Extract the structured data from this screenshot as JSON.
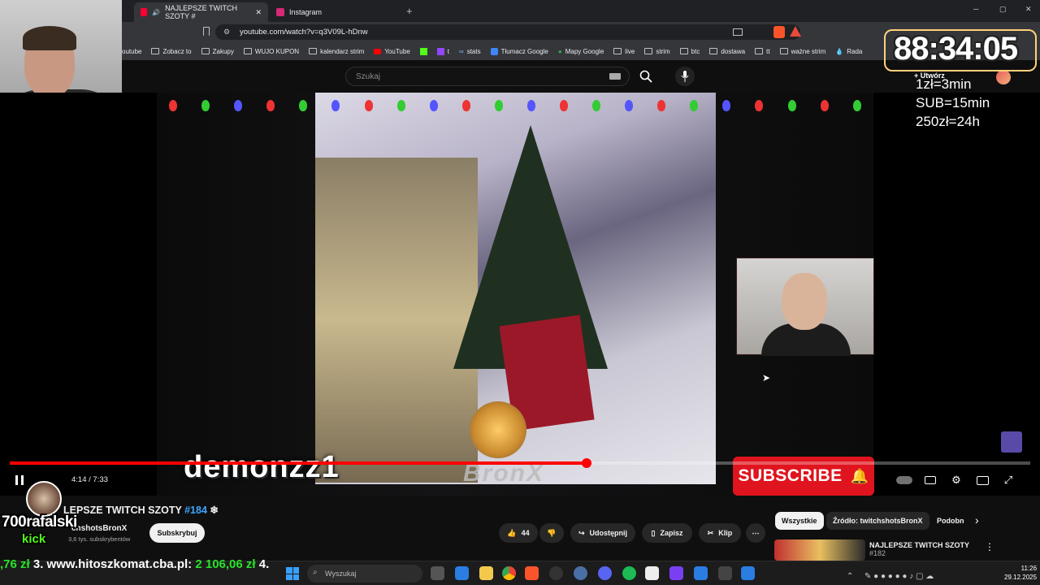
{
  "tabs": [
    {
      "label": "NAJLEPSZE TWITCH SZOTY #",
      "close": "✕",
      "icon_color": "#ff0033",
      "icon": "youtube-icon"
    },
    {
      "label": "Instagram",
      "icon_color": "#d62976",
      "icon": "instagram-icon"
    }
  ],
  "new_tab": "+",
  "window_controls": {
    "minimize": "─",
    "maximize": "▢",
    "close": "✕"
  },
  "address": {
    "url": "youtube.com/watch?v=q3V09L-hDnw"
  },
  "bookmarks": [
    {
      "label": "outube"
    },
    {
      "label": "Zobacz to"
    },
    {
      "label": "Zakupy"
    },
    {
      "label": "WUJO KUPON"
    },
    {
      "label": "kalendarz strim"
    },
    {
      "label": "YouTube"
    },
    {
      "label": "t"
    },
    {
      "label": "stats"
    },
    {
      "label": "Tłumacz Google"
    },
    {
      "label": "Mapy Google"
    },
    {
      "label": "live"
    },
    {
      "label": "strim"
    },
    {
      "label": "btc"
    },
    {
      "label": "dostawa"
    },
    {
      "label": "tt"
    },
    {
      "label": "ważne strim"
    },
    {
      "label": "Rada"
    }
  ],
  "youtube": {
    "search_placeholder": "Szukaj",
    "create_label": "Utwórz"
  },
  "overlay": {
    "timer": "88:34:05",
    "rates": [
      "1zł=3min",
      "SUB=15min",
      "250zł=24h"
    ],
    "username": "demonzz1",
    "watermark": "BronX",
    "subscribe": "SUBSCRIBE",
    "logo_name": "700rafalski",
    "logo_platform": "kick",
    "ticker": [
      {
        "text": ",76 zł",
        "color": "#29e329"
      },
      {
        "text": " 3. www.hitoszkomat.cba.pl: ",
        "color": "#ffffff"
      },
      {
        "text": "2 106,06 zł",
        "color": "#29e329"
      },
      {
        "text": " 4.",
        "color": "#ffffff"
      }
    ]
  },
  "player": {
    "time": "4:14 / 7:33",
    "progress": 0.565
  },
  "video": {
    "title": "NAJLEPSZE TWITCH SZOTY",
    "title_visible": "LEPSZE TWITCH SZOTY",
    "hashtag": "#184",
    "channel": "twitchshotsBronX",
    "channel_visible": "chshotsBronX",
    "subscribers": "3,6 tys. subskrybentów",
    "subscribe_label": "Subskrybuj",
    "likes": "44",
    "share": "Udostępnij",
    "save": "Zapisz",
    "clip": "Klip",
    "more": "⋯"
  },
  "chips": [
    {
      "label": "Wszystkie",
      "selected": true
    },
    {
      "label": "Źródło: twitchshotsBronX",
      "selected": false
    },
    {
      "label": "Podobne",
      "selected": false
    }
  ],
  "recommended": {
    "title": "NAJLEPSZE TWITCH SZOTY",
    "sub": "#182"
  },
  "taskbar": {
    "search_placeholder": "Wyszukaj",
    "time": "11:26",
    "date": "29.12.2025"
  },
  "colors": {
    "accent": "#ff0000",
    "brand_green": "#53fc18",
    "link": "#3ea6ff"
  }
}
